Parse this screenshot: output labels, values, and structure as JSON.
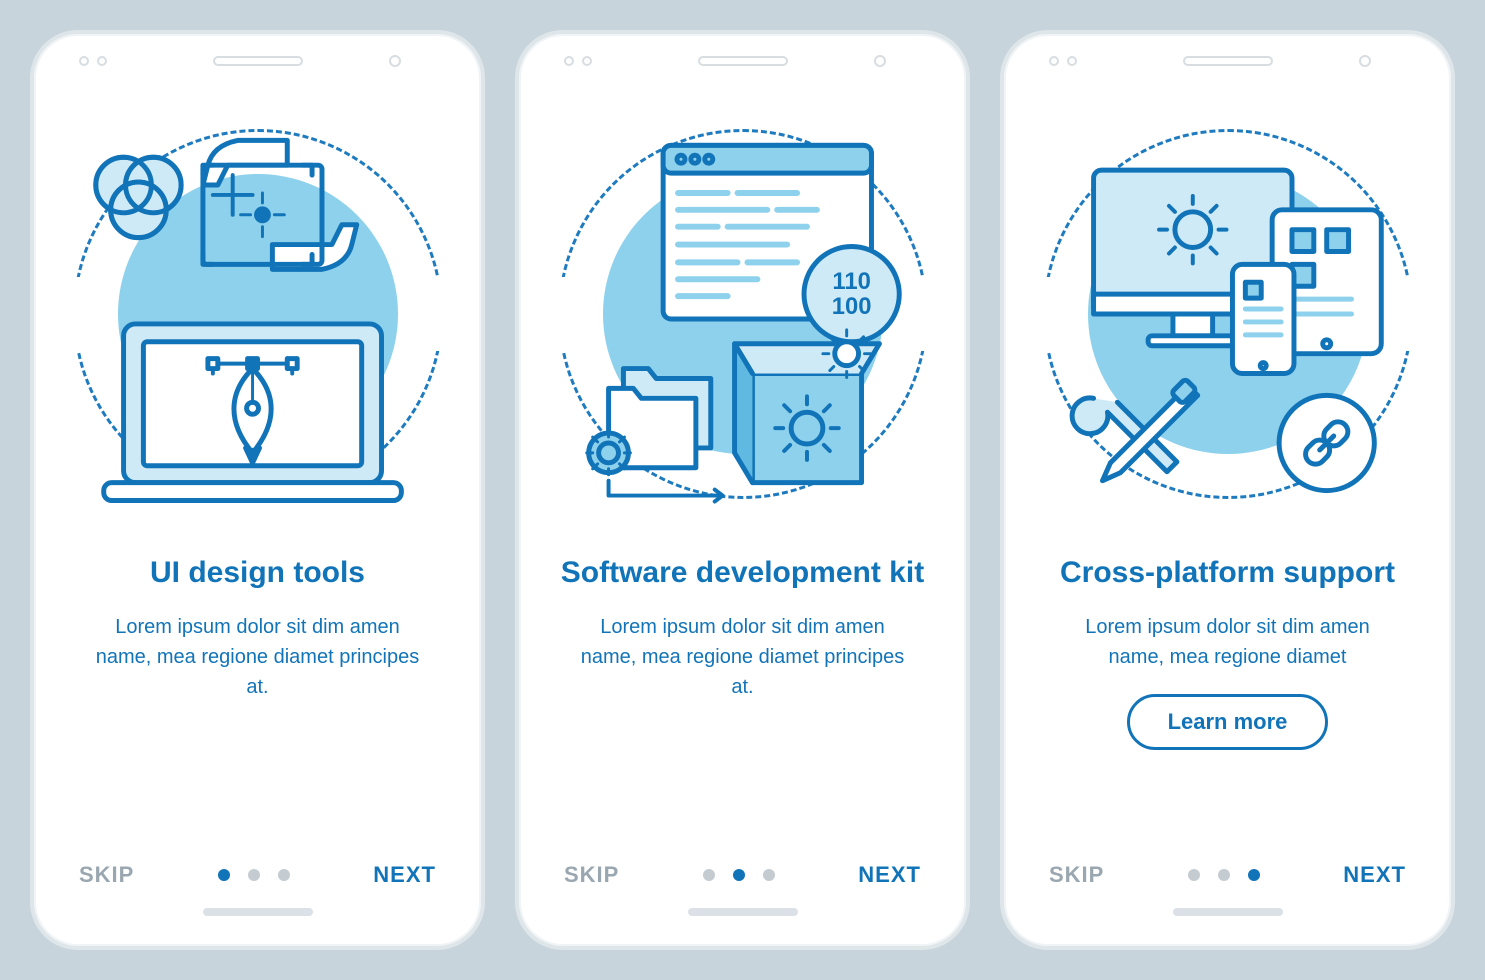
{
  "colors": {
    "primary": "#1274b8",
    "accent": "#8dd1ec",
    "muted": "#9aa7b0"
  },
  "screens": [
    {
      "title": "UI design tools",
      "description": "Lorem ipsum dolor sit dim amen name, mea regione diamet principes at.",
      "skip": "SKIP",
      "next": "NEXT",
      "active_page": 0,
      "icon": "design-tools",
      "has_button": false
    },
    {
      "title": "Software development kit",
      "description": "Lorem ipsum dolor sit dim amen name, mea regione diamet principes at.",
      "skip": "SKIP",
      "next": "NEXT",
      "active_page": 1,
      "icon": "sdk",
      "has_button": false
    },
    {
      "title": "Cross-platform support",
      "description": "Lorem ipsum dolor sit dim amen name, mea regione diamet",
      "skip": "SKIP",
      "next": "NEXT",
      "button_label": "Learn more",
      "active_page": 2,
      "icon": "cross-platform",
      "has_button": true
    }
  ]
}
